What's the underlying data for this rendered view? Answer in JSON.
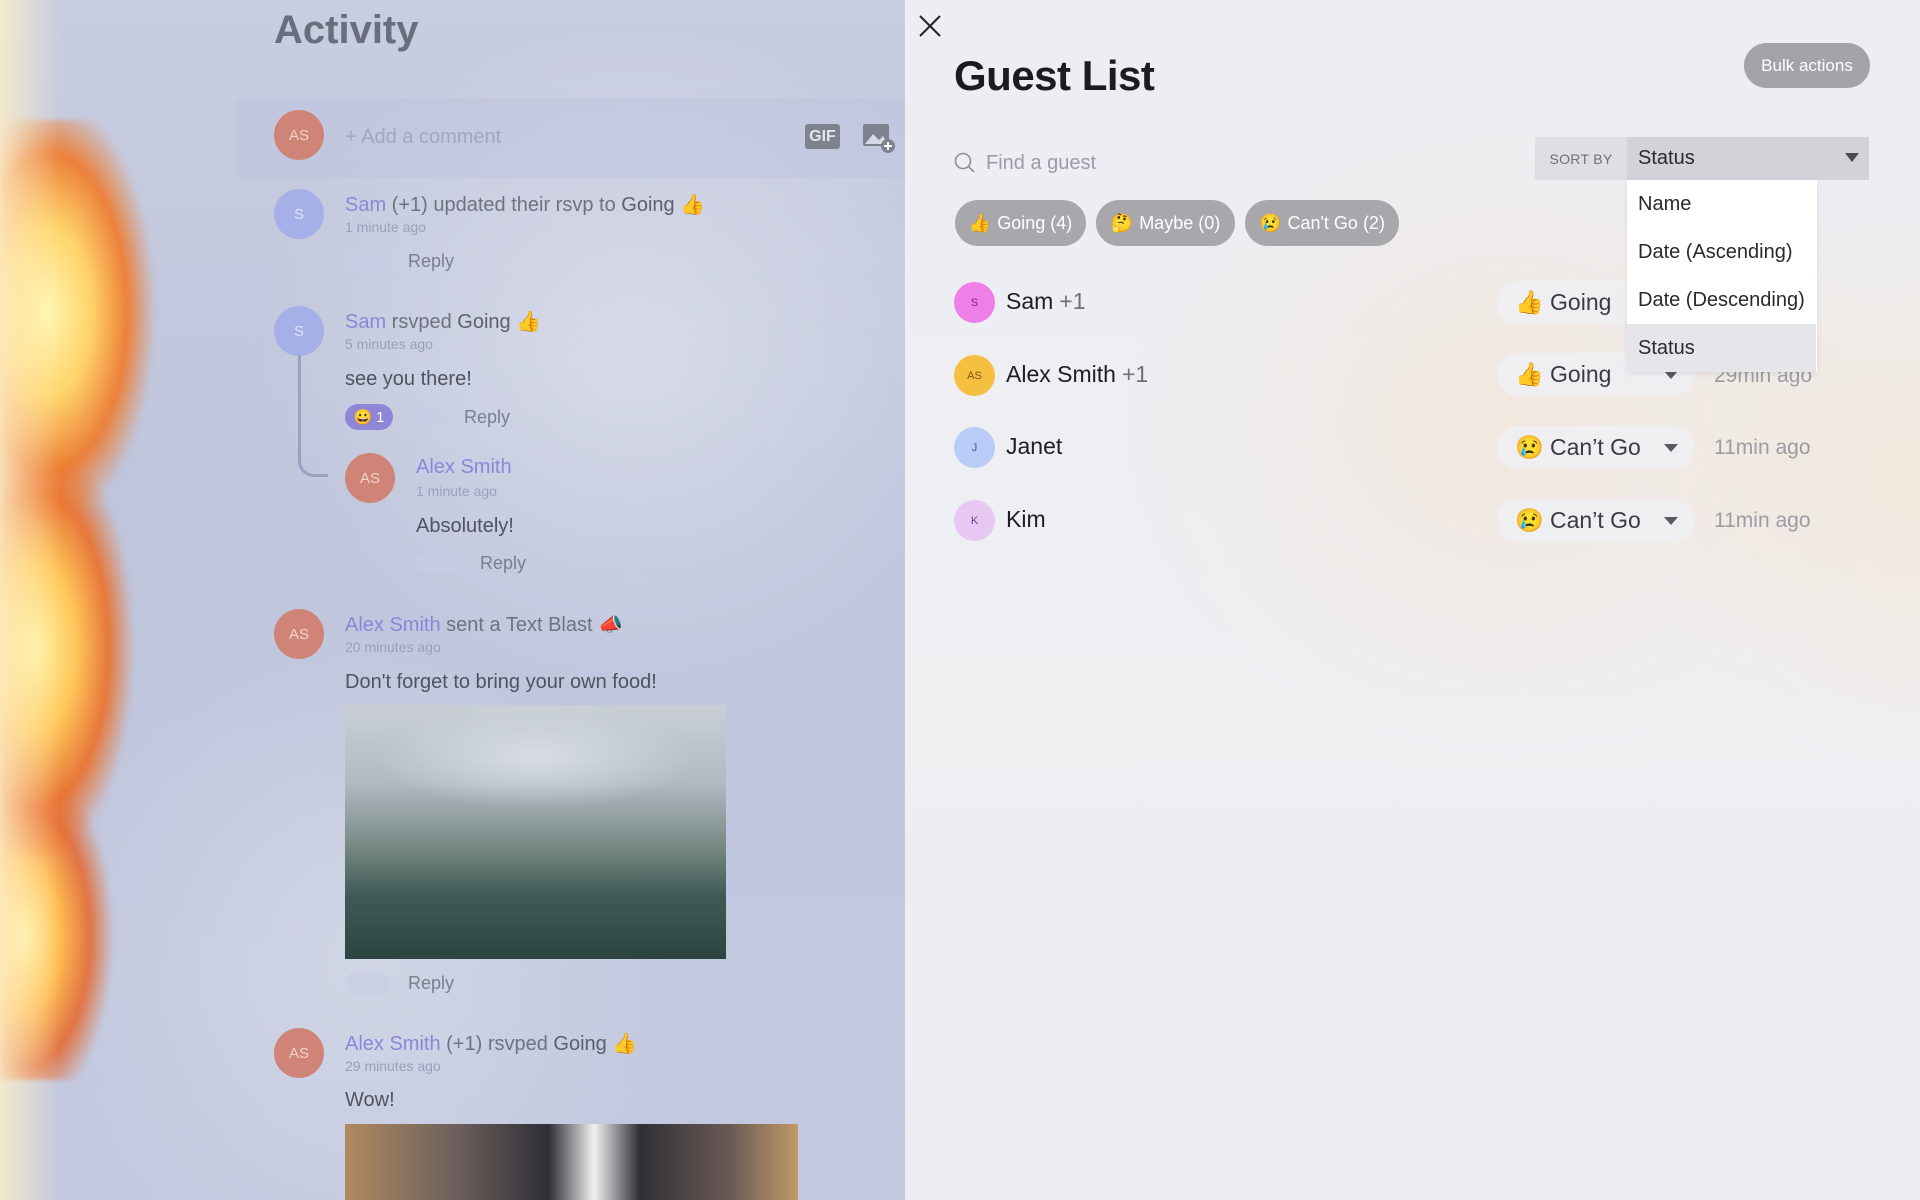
{
  "activity": {
    "title": "Activity",
    "composer": {
      "avatar": "AS",
      "placeholder": "+ Add a comment",
      "gif_label": "GIF",
      "image_icon": "add-image-icon"
    },
    "feed": [
      {
        "avatar": "S",
        "name": "Sam",
        "action": " (+1) updated their rsvp to ",
        "status": "Going",
        "emoji": "👍",
        "time": "1 minute ago",
        "reply": "Reply"
      },
      {
        "avatar": "S",
        "name": "Sam",
        "action": " rsvped ",
        "status": "Going",
        "emoji": "👍",
        "time": "5 minutes ago",
        "body": "see you there!",
        "reaction_emoji": "😀",
        "reaction_count": "1",
        "reply": "Reply"
      },
      {
        "avatar": "AS",
        "name": "Alex Smith",
        "time": "1 minute ago",
        "body": "Absolutely!",
        "reply": "Reply"
      },
      {
        "avatar": "AS",
        "name": "Alex Smith",
        "action": " sent a Text Blast ",
        "emoji": "📣",
        "time": "20 minutes ago",
        "body": "Don't forget to bring your own food!",
        "reply": "Reply"
      },
      {
        "avatar": "AS",
        "name": "Alex Smith",
        "action": " (+1) rsvped ",
        "status": "Going",
        "emoji": "👍",
        "time": "29 minutes ago",
        "body": "Wow!"
      }
    ]
  },
  "guest_list": {
    "title": "Guest List",
    "bulk_actions": "Bulk actions",
    "search_placeholder": "Find a guest",
    "sort_label": "SORT BY",
    "sort_value": "Status",
    "sort_options": [
      "Name",
      "Date (Ascending)",
      "Date (Descending)",
      "Status"
    ],
    "filters": [
      {
        "emoji": "👍",
        "label": "Going (4)"
      },
      {
        "emoji": "🤔",
        "label": "Maybe (0)"
      },
      {
        "emoji": "😢",
        "label": "Can't Go (2)"
      }
    ],
    "guests": [
      {
        "initials": "S",
        "name": "Sam",
        "plus": "+1",
        "status_emoji": "👍",
        "status": "Going",
        "time": "",
        "avatar_color": "#f07ee8",
        "avatar_text_color": "#7a2a74"
      },
      {
        "initials": "AS",
        "name": "Alex Smith",
        "plus": "+1",
        "status_emoji": "👍",
        "status": "Going",
        "time": "29min ago",
        "avatar_color": "#f5c040",
        "avatar_text_color": "#7a5a10"
      },
      {
        "initials": "J",
        "name": "Janet",
        "plus": "",
        "status_emoji": "😢",
        "status": "Can’t Go",
        "time": "11min ago",
        "avatar_color": "#b9ccf7",
        "avatar_text_color": "#3a5aa0"
      },
      {
        "initials": "K",
        "name": "Kim",
        "plus": "",
        "status_emoji": "😢",
        "status": "Can’t Go",
        "time": "11min ago",
        "avatar_color": "#e6c8f2",
        "avatar_text_color": "#7a3a90"
      }
    ]
  }
}
